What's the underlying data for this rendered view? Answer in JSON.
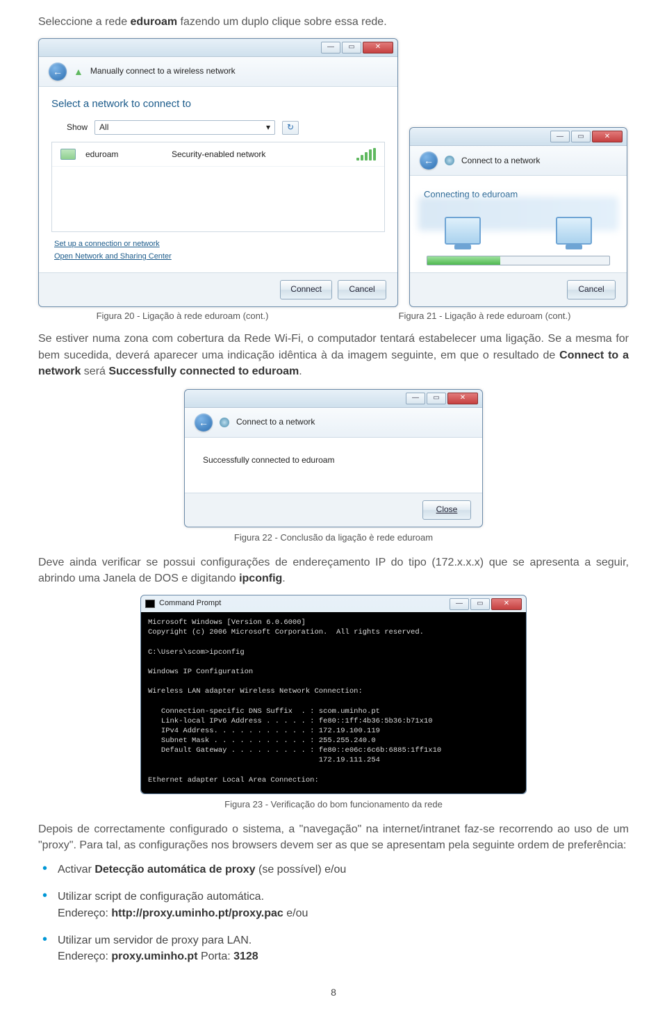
{
  "intro": {
    "prefix": "Seleccione a rede ",
    "bold": "eduroam",
    "suffix": " fazendo um duplo clique sobre essa rede."
  },
  "fig20": {
    "header_title": "Manually connect to a wireless network",
    "heading": "Select a network to connect to",
    "show_label": "Show",
    "show_value": "All",
    "network_name": "eduroam",
    "network_type": "Security-enabled network",
    "link1": "Set up a connection or network",
    "link2": "Open Network and Sharing Center",
    "btn_connect": "Connect",
    "btn_cancel": "Cancel",
    "caption": "Figura 20 - Ligação à rede eduroam (cont.)"
  },
  "fig21": {
    "header_title": "Connect to a network",
    "heading": "Connecting to eduroam",
    "btn_cancel": "Cancel",
    "caption": "Figura 21 - Ligação à rede eduroam (cont.)"
  },
  "para1": {
    "t1": "Se estiver numa zona com cobertura da Rede Wi-Fi, o computador tentará estabelecer uma ligação. Se a mesma for bem sucedida, deverá aparecer uma indicação idêntica à da imagem seguinte, em que o resultado de ",
    "b1": "Connect to a network",
    "t2": " será ",
    "b2": "Successfully connected to eduroam",
    "t3": "."
  },
  "fig22": {
    "header_title": "Connect to a network",
    "msg": "Successfully connected to eduroam",
    "btn_close": "Close",
    "caption": "Figura 22 - Conclusão da ligação è rede eduroam"
  },
  "para2": {
    "t1": "Deve ainda verificar se possui configurações de endereçamento IP do tipo (172.x.x.x) que se apresenta a seguir, abrindo uma Janela de DOS e digitando ",
    "b1": "ipconfig",
    "t2": "."
  },
  "cmd": {
    "title": "Command Prompt",
    "lines": "Microsoft Windows [Version 6.0.6000]\nCopyright (c) 2006 Microsoft Corporation.  All rights reserved.\n\nC:\\Users\\scom>ipconfig\n\nWindows IP Configuration\n\nWireless LAN adapter Wireless Network Connection:\n\n   Connection-specific DNS Suffix  . : scom.uminho.pt\n   Link-local IPv6 Address . . . . . : fe80::1ff:4b36:5b36:b71x10\n   IPv4 Address. . . . . . . . . . . : 172.19.100.119\n   Subnet Mask . . . . . . . . . . . : 255.255.240.0\n   Default Gateway . . . . . . . . . : fe80::e06c:6c6b:6885:1ff1x10\n                                       172.19.111.254\n\nEthernet adapter Local Area Connection:"
  },
  "fig23_caption": "Figura 23 - Verificação do bom funcionamento da rede",
  "para3": "Depois de correctamente configurado o sistema, a \"navegação\" na internet/intranet faz-se recorrendo ao uso de um \"proxy\". Para tal, as configurações nos browsers devem ser as que se apresentam pela seguinte ordem de preferência:",
  "bullets": {
    "b1_t1": "Activar ",
    "b1_b": "Detecção automática de proxy",
    "b1_t2": " (se possível) e/ou",
    "b2_l1": "Utilizar script de configuração automática.",
    "b2_l2a": "Endereço: ",
    "b2_l2b": "http://proxy.uminho.pt/proxy.pac",
    "b2_l2c": " e/ou",
    "b3_l1": "Utilizar um servidor de proxy para LAN.",
    "b3_l2a": "Endereço: ",
    "b3_l2b": "proxy.uminho.pt",
    "b3_l2c": " Porta: ",
    "b3_l2d": "3128"
  },
  "page_number": "8"
}
